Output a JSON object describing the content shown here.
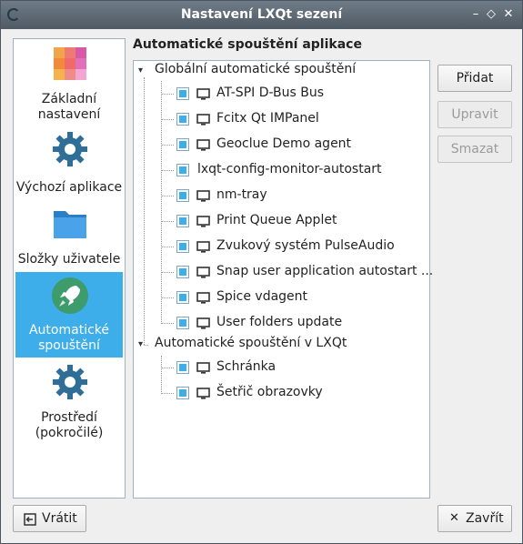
{
  "window": {
    "title": "Nastavení LXQt sezení",
    "controls": [
      "–",
      "◇",
      "✕"
    ]
  },
  "sidebar": {
    "items": [
      {
        "label": "Základní nastavení",
        "icon": "palette-icon",
        "active": false
      },
      {
        "label": "Výchozí aplikace",
        "icon": "gear-icon",
        "active": false
      },
      {
        "label": "Složky uživatele",
        "icon": "folder-icon",
        "active": false
      },
      {
        "label": "Automatické spouštění",
        "icon": "rocket-icon",
        "active": true
      },
      {
        "label": "Prostředí (pokročilé)",
        "icon": "gear-icon",
        "active": false
      }
    ]
  },
  "main": {
    "title": "Automatické spouštění aplikace",
    "groups": [
      {
        "label": "Globální automatické spouštění",
        "expanded": true,
        "items": [
          {
            "label": "AT-SPI D-Bus Bus",
            "checked": true,
            "icon": "monitor-icon"
          },
          {
            "label": "Fcitx Qt IMPanel",
            "checked": true,
            "icon": "monitor-icon"
          },
          {
            "label": "Geoclue Demo agent",
            "checked": true,
            "icon": "monitor-icon"
          },
          {
            "label": "lxqt-config-monitor-autostart",
            "checked": true,
            "icon": ""
          },
          {
            "label": "nm-tray",
            "checked": true,
            "icon": "monitor-icon"
          },
          {
            "label": "Print Queue Applet",
            "checked": true,
            "icon": "monitor-icon"
          },
          {
            "label": "Zvukový systém PulseAudio",
            "checked": true,
            "icon": "monitor-icon"
          },
          {
            "label": "Snap user application autostart ...",
            "checked": true,
            "icon": "monitor-icon"
          },
          {
            "label": "Spice vdagent",
            "checked": true,
            "icon": "monitor-icon"
          },
          {
            "label": "User folders update",
            "checked": true,
            "icon": "monitor-icon"
          }
        ]
      },
      {
        "label": "Automatické spouštění v LXQt",
        "expanded": true,
        "items": [
          {
            "label": "Schránka",
            "checked": true,
            "icon": "monitor-icon"
          },
          {
            "label": "Šetřič obrazovky",
            "checked": true,
            "icon": "monitor-icon"
          }
        ]
      }
    ],
    "buttons": {
      "add": "Přidat",
      "edit": "Upravit",
      "delete": "Smazat"
    }
  },
  "footer": {
    "reset": "Vrátit",
    "close": "Zavřít"
  },
  "colors": {
    "accent": "#3daee9",
    "titlebar": "#5b6670"
  }
}
